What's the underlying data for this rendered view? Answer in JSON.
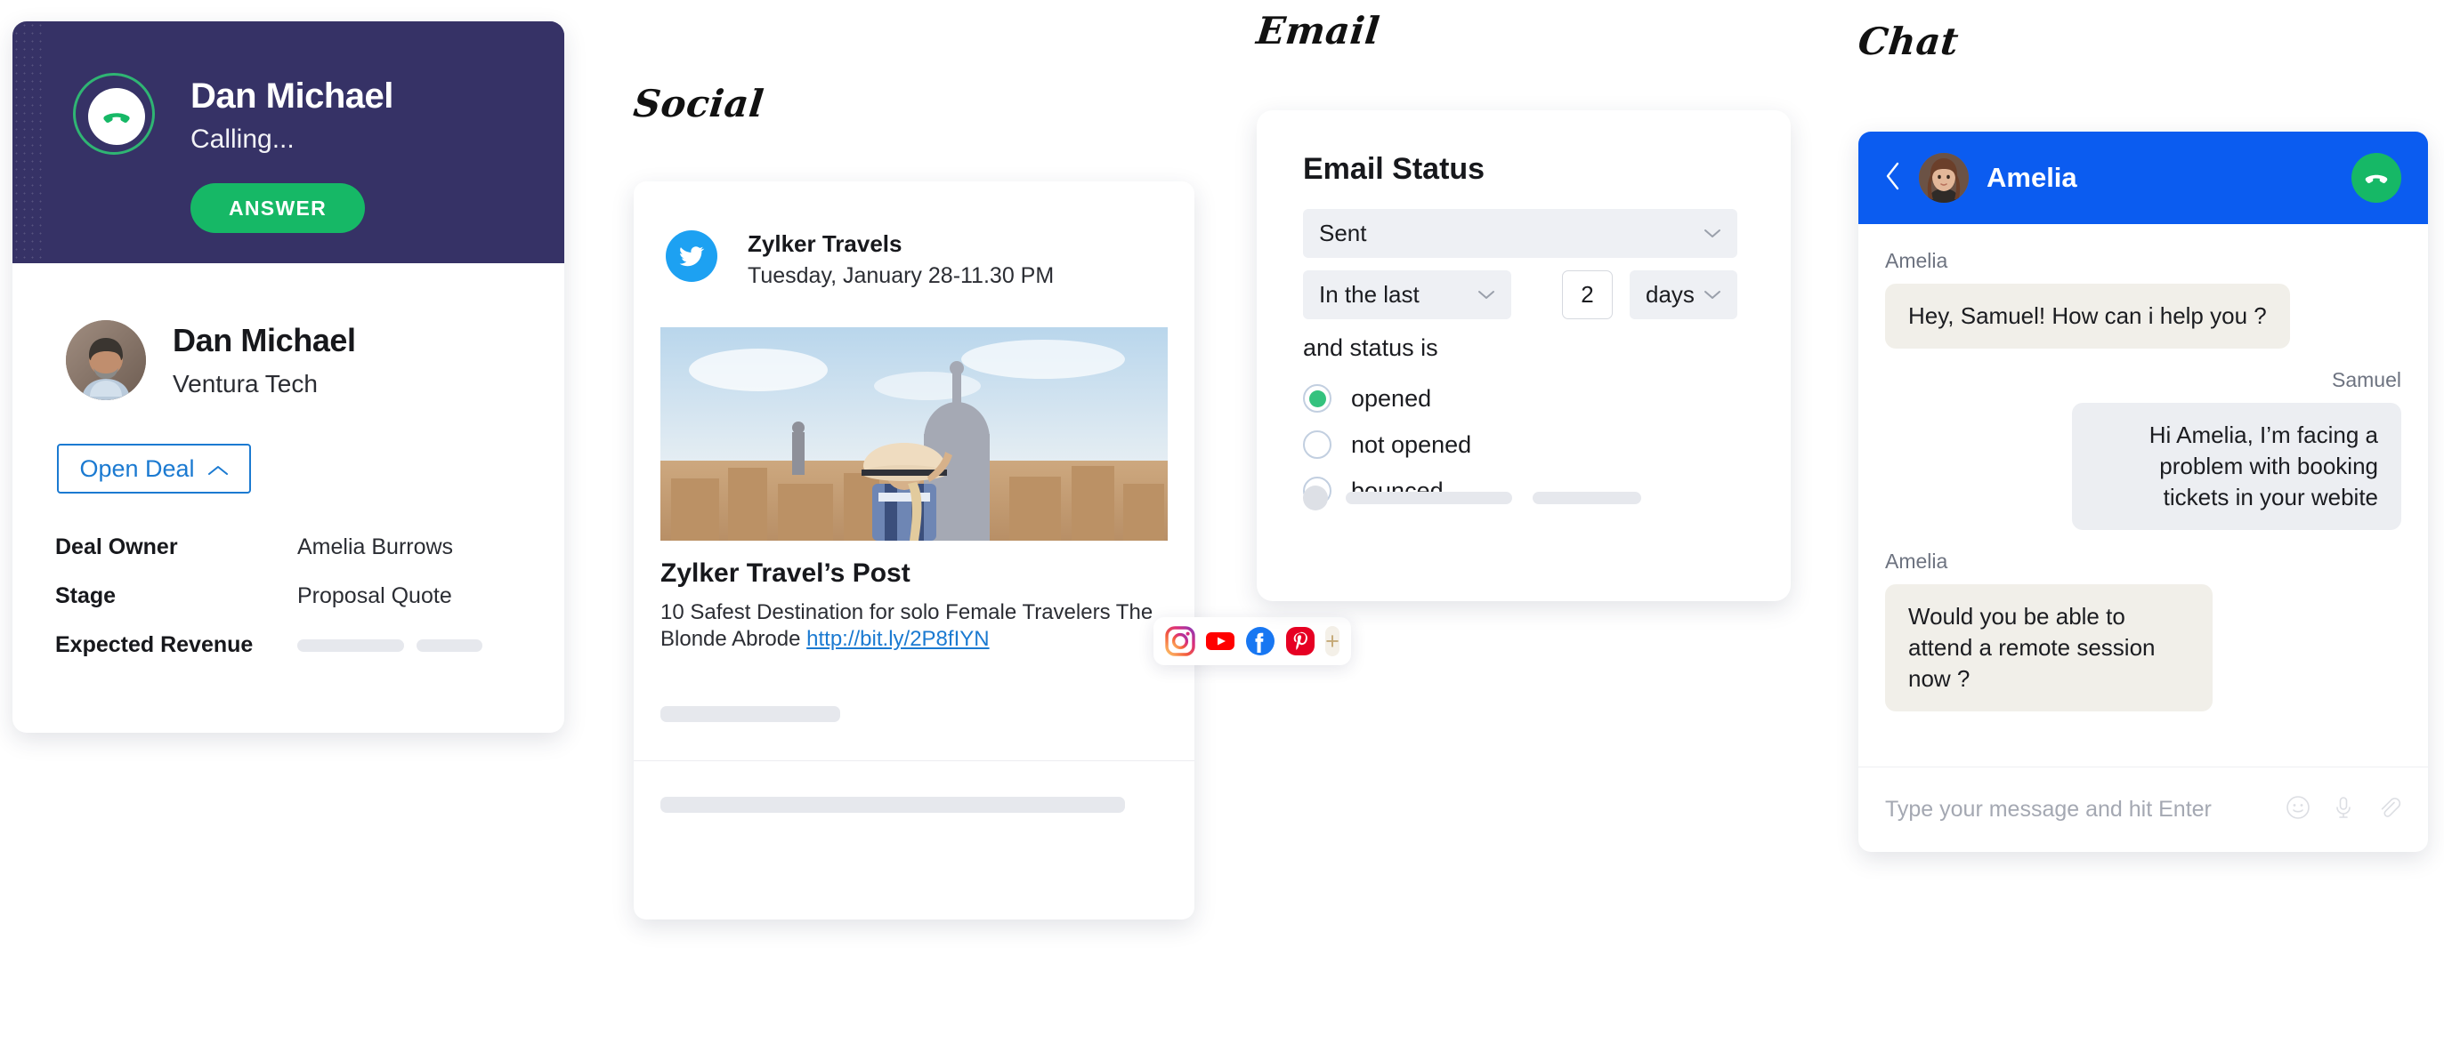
{
  "sections": {
    "social_label": "Social",
    "email_label": "Email",
    "chat_label": "Chat"
  },
  "call": {
    "caller_name": "Dan Michael",
    "status": "Calling...",
    "answer_label": "ANSWER",
    "phone_icon": "phone-handset-icon",
    "contact": {
      "name": "Dan Michael",
      "company": "Ventura Tech",
      "avatar": "contact-avatar"
    },
    "open_deal_label": "Open Deal",
    "open_deal_chevron": "chevron-up-icon",
    "fields": [
      {
        "key": "Deal Owner",
        "value": "Amelia Burrows",
        "skeleton": false
      },
      {
        "key": "Stage",
        "value": "Proposal Quote",
        "skeleton": false
      },
      {
        "key": "Expected Revenue",
        "value": "",
        "skeleton": true
      }
    ]
  },
  "social": {
    "network_icon": "twitter-icon",
    "account": "Zylker Travels",
    "timestamp": "Tuesday, January 28-11.30 PM",
    "image_alt": "traveler-with-hat-overlooking-city",
    "post_title": "Zylker Travel’s Post",
    "post_text": "10 Safest Destination for solo Female Travelers The Blonde Abrode ",
    "post_link": "http://bit.ly/2P8fIYN",
    "network_bar": [
      {
        "name": "instagram-icon",
        "color": "#E1306C"
      },
      {
        "name": "youtube-icon",
        "color": "#FF0000"
      },
      {
        "name": "facebook-icon",
        "color": "#1877F2"
      },
      {
        "name": "pinterest-icon",
        "color": "#E60023"
      }
    ],
    "add_network_label": "+"
  },
  "email": {
    "title": "Email Status",
    "status_select": {
      "value": "Sent",
      "chevron": "chevron-down-icon"
    },
    "range_select": {
      "value": "In the last",
      "chevron": "chevron-down-icon"
    },
    "range_amount": "2",
    "unit_select": {
      "value": "days",
      "chevron": "chevron-down-icon"
    },
    "and_status_label": "and status is",
    "options": [
      {
        "label": "opened",
        "selected": true
      },
      {
        "label": "not opened",
        "selected": false
      },
      {
        "label": "bounced",
        "selected": false
      }
    ],
    "accent": "#34c27e"
  },
  "chat": {
    "back_icon": "chevron-left-icon",
    "avatar": "amelia-avatar",
    "contact": "Amelia",
    "hangup_icon": "phone-hangup-icon",
    "messages": [
      {
        "sender": "Amelia",
        "side": "left",
        "text": "Hey, Samuel! How can i help you ?"
      },
      {
        "sender": "Samuel",
        "side": "right",
        "text": "Hi Amelia, I’m facing a problem with booking tickets in your webite"
      },
      {
        "sender": "Amelia",
        "side": "left",
        "text": "Would you be able to attend a remote session now ?"
      }
    ],
    "input_placeholder": "Type your message and hit Enter",
    "input_icons": [
      "emoji-icon",
      "microphone-icon",
      "attachment-icon"
    ]
  },
  "colors": {
    "call_header": "#363266",
    "answer_green": "#16b866",
    "chat_blue": "#0b5cf0",
    "link_blue": "#1b7ad1"
  }
}
